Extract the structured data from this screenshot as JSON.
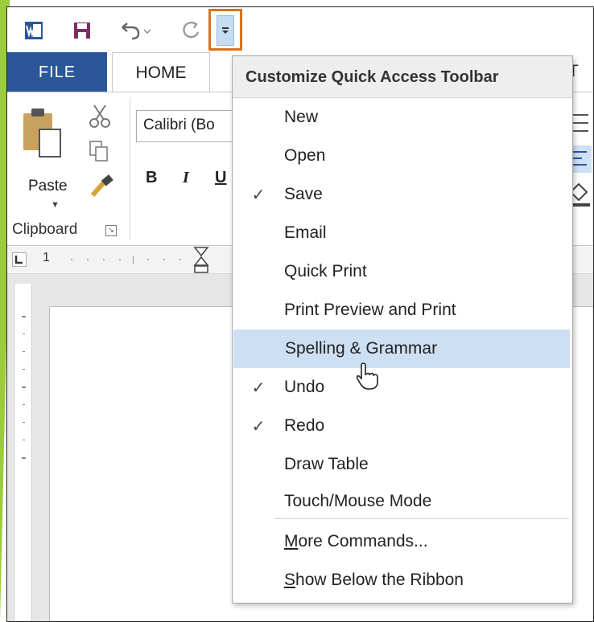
{
  "qat": {
    "icons": [
      "word-logo-icon",
      "save-icon",
      "undo-icon",
      "redo-icon",
      "customize-dropdown-icon"
    ]
  },
  "tabs": {
    "file": "FILE",
    "home": "HOME",
    "partial_right": "T"
  },
  "ribbon": {
    "paste_label": "Paste",
    "clipboard_group": "Clipboard",
    "font_name": "Calibri (Bo",
    "bold": "B",
    "italic": "I",
    "underline": "U"
  },
  "ruler": {
    "mark": "1"
  },
  "menu": {
    "header": "Customize Quick Access Toolbar",
    "items": [
      {
        "label": "New",
        "checked": false
      },
      {
        "label": "Open",
        "checked": false
      },
      {
        "label": "Save",
        "checked": true
      },
      {
        "label": "Email",
        "checked": false
      },
      {
        "label": "Quick Print",
        "checked": false
      },
      {
        "label": "Print Preview and Print",
        "checked": false
      },
      {
        "label": "Spelling & Grammar",
        "checked": false,
        "hovered": true
      },
      {
        "label": "Undo",
        "checked": true
      },
      {
        "label": "Redo",
        "checked": true
      },
      {
        "label": "Draw Table",
        "checked": false
      },
      {
        "label": "Touch/Mouse Mode",
        "checked": false
      }
    ],
    "more_commands": {
      "accel": "M",
      "rest": "ore Commands..."
    },
    "show_below": {
      "accel": "S",
      "rest": "how Below the Ribbon"
    },
    "check_glyph": "✓"
  },
  "colors": {
    "file_tab": "#2b579a",
    "highlight_box": "#d9731f",
    "hover": "#cddff2",
    "accent_slash": "#9ccc3c"
  }
}
